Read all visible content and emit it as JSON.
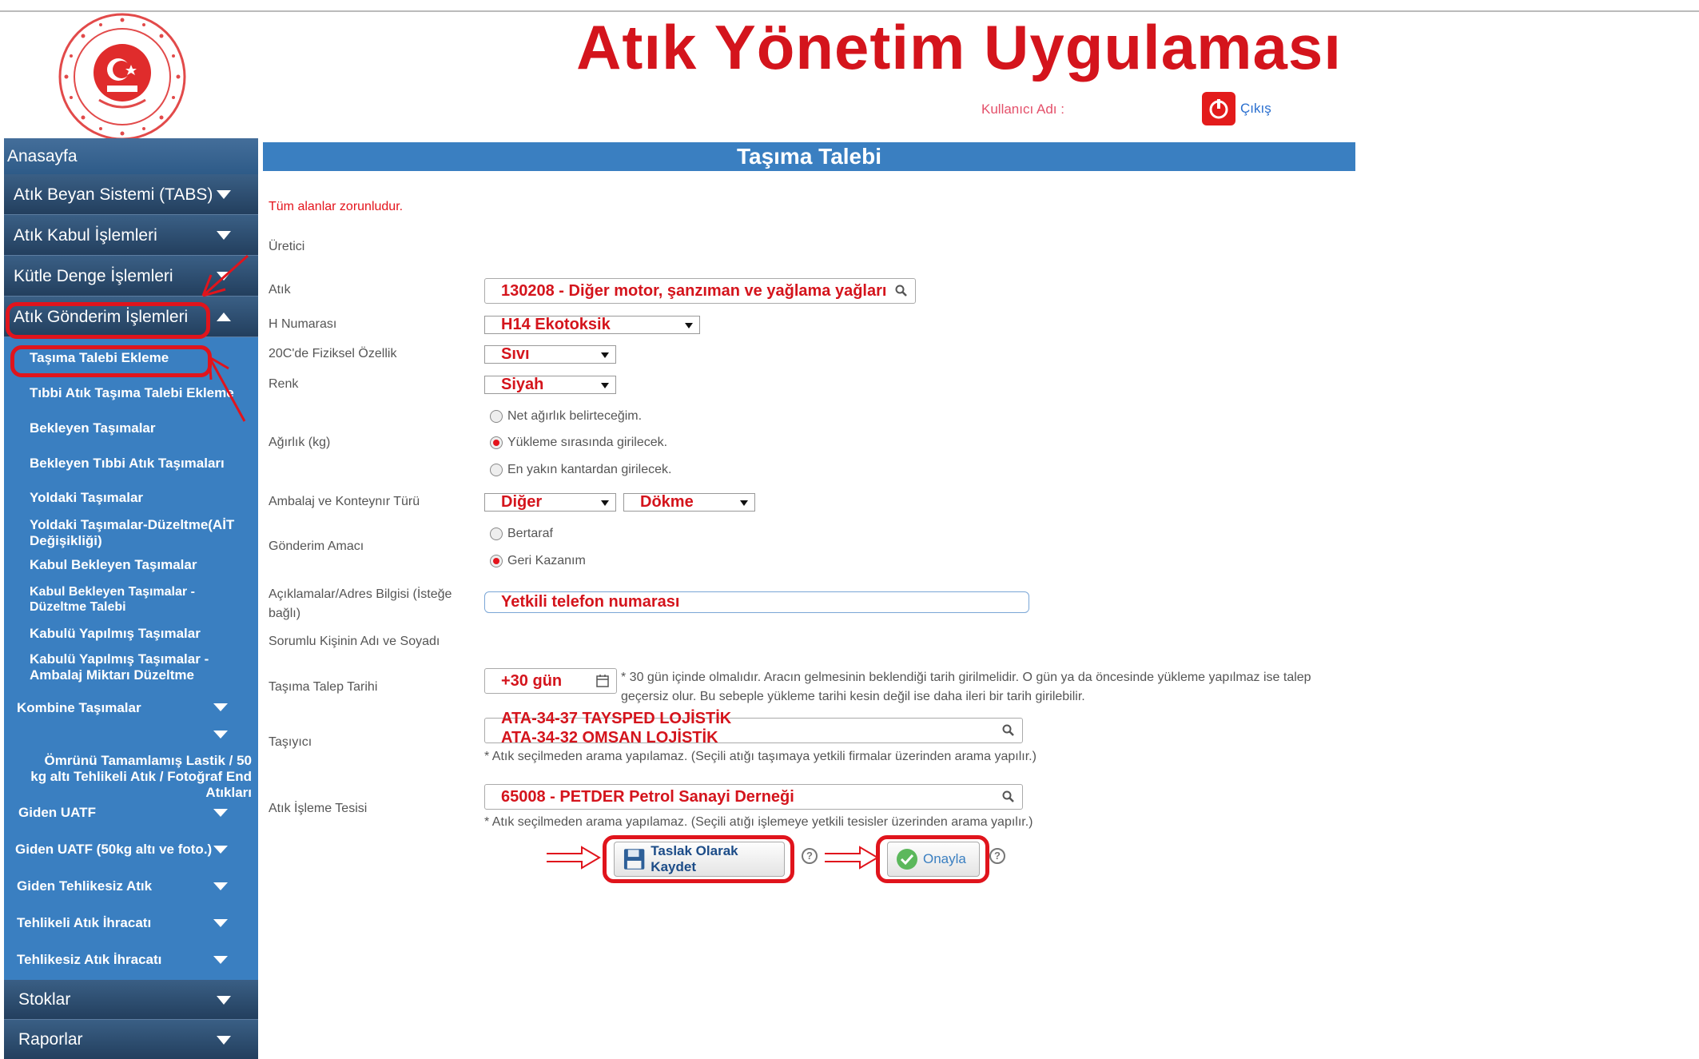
{
  "app": {
    "title": "Atık Yönetim Uygulaması",
    "user_label": "Kullanıcı Adı :",
    "logout_label": "Çıkış"
  },
  "sidebar": {
    "home": "Anasayfa",
    "sections": [
      {
        "label": "Atık Beyan Sistemi (TABS)"
      },
      {
        "label": "Atık Kabul İşlemleri"
      },
      {
        "label": "Kütle Denge İşlemleri"
      },
      {
        "label": "Atık Gönderim İşlemleri"
      }
    ],
    "sub_items": [
      "Taşıma Talebi Ekleme",
      "Tıbbi Atık Taşıma Talebi Ekleme",
      "Bekleyen Taşımalar",
      "Bekleyen Tıbbi Atık Taşımaları",
      "Yoldaki Taşımalar",
      "Yoldaki Taşımalar-Düzeltme(AİT Değişikliği)",
      "Kabul Bekleyen Taşımalar",
      "Kabul Bekleyen Taşımalar - Düzeltme Talebi",
      "Kabulü Yapılmış Taşımalar",
      "Kabulü Yapılmış Taşımalar - Ambalaj Miktarı Düzeltme"
    ],
    "groups": [
      "Kombine Taşımalar",
      "Ömrünü Tamamlamış Lastik / 50 kg altı Tehlikeli Atık / Fotoğraf End Atıkları",
      "Giden UATF",
      "Giden UATF (50kg altı ve foto.)",
      "Giden Tehlikesiz Atık",
      "Tehlikeli Atık İhracatı",
      "Tehlikesiz Atık İhracatı"
    ],
    "bottom": [
      "Stoklar",
      "Raporlar"
    ]
  },
  "form": {
    "header": "Taşıma Talebi",
    "required_note": "Tüm alanlar zorunludur.",
    "labels": {
      "producer": "Üretici",
      "waste": "Atık",
      "h_number": "H Numarası",
      "physical": "20C'de Fiziksel Özellik",
      "color": "Renk",
      "weight": "Ağırlık (kg)",
      "packaging": "Ambalaj ve Konteynır Türü",
      "purpose": "Gönderim Amacı",
      "notes": "Açıklamalar/Adres Bilgisi (İsteğe bağlı)",
      "responsible": "Sorumlu Kişinin Adı ve Soyadı",
      "date": "Taşıma Talep Tarihi",
      "carrier": "Taşıyıcı",
      "facility": "Atık İşleme Tesisi"
    },
    "values": {
      "waste": "130208 - Diğer motor, şanzıman ve yağlama yağları",
      "h_number": "H14 Ekotoksik",
      "physical": "Sıvı",
      "color": "Siyah",
      "packaging_1": "Diğer",
      "packaging_2": "Dökme",
      "notes": "Yetkili telefon numarası",
      "date": "+30 gün",
      "carrier_1": "ATA-34-37 TAYSPED LOJİSTİK",
      "carrier_2": "ATA-34-32 OMSAN LOJİSTİK",
      "facility": "65008 - PETDER Petrol Sanayi Derneği"
    },
    "weight_options": [
      "Net ağırlık belirteceğim.",
      "Yükleme sırasında girilecek.",
      "En yakın kantardan girilecek."
    ],
    "purpose_options": [
      "Bertaraf",
      "Geri Kazanım"
    ],
    "date_note": "* 30 gün içinde olmalıdır. Aracın gelmesinin beklendiği tarih girilmelidir. O gün ya da öncesinde yükleme yapılmaz ise talep geçersiz olur. Bu sebeple yükleme tarihi kesin değil ise daha ileri bir tarih girilebilir.",
    "carrier_note": "* Atık seçilmeden arama yapılamaz. (Seçili atığı taşımaya yetkili firmalar üzerinden arama yapılır.)",
    "facility_note": "* Atık seçilmeden arama yapılamaz. (Seçili atığı işlemeye yetkili tesisler üzerinden arama yapılır.)",
    "save_draft": "Taslak Olarak Kaydet",
    "approve": "Onayla",
    "help": "?"
  },
  "colors": {
    "brand_red": "#d4141c",
    "sidebar_blue": "#3a7fc1",
    "header_blue": "#3a7fc1"
  }
}
